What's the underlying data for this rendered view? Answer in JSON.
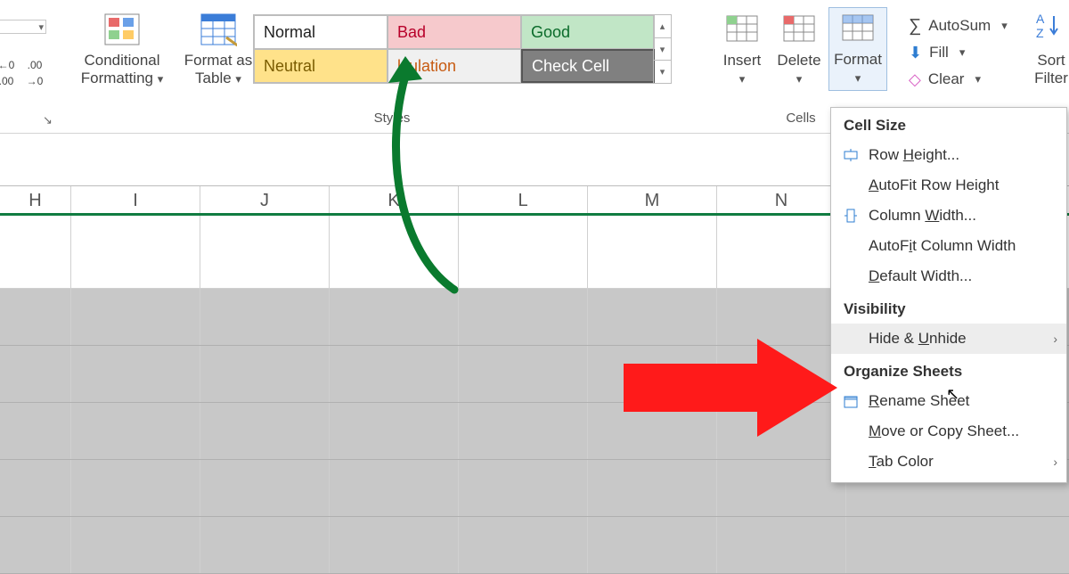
{
  "ribbon": {
    "styles_group_label": "Styles",
    "cells_group_label": "Cells",
    "conditional_formatting": "Conditional\nFormatting",
    "format_as_table": "Format as\nTable",
    "insert": "Insert",
    "delete": "Delete",
    "format": "Format",
    "editing": {
      "autosum": "AutoSum",
      "fill": "Fill",
      "clear": "Clear"
    },
    "sort_filter": "Sort &\nFilter"
  },
  "cell_styles": {
    "row1": [
      "Normal",
      "Bad",
      "Good"
    ],
    "row2": [
      "Neutral",
      "lculation",
      "Check Cell"
    ]
  },
  "columns": [
    "H",
    "I",
    "J",
    "K",
    "L",
    "M",
    "N"
  ],
  "format_menu": {
    "section_cell_size": "Cell Size",
    "row_height": "Row Height...",
    "autofit_row_height": "AutoFit Row Height",
    "column_width": "Column Width...",
    "autofit_column_width": "AutoFit Column Width",
    "default_width": "Default Width...",
    "section_visibility": "Visibility",
    "hide_unhide": "Hide & Unhide",
    "section_organize": "Organize Sheets",
    "rename_sheet": "Rename Sheet",
    "move_or_copy": "Move or Copy Sheet...",
    "tab_color": "Tab Color"
  },
  "colors": {
    "bad_bg": "#f6c9cc",
    "bad_fg": "#b8002a",
    "good_bg": "#c1e6c6",
    "good_fg": "#0a6b2a",
    "neutral_bg": "#ffe28a",
    "neutral_fg": "#7a5c00",
    "calc_fg": "#c75b12",
    "check_bg": "#808080",
    "check_fg": "#ffffff",
    "excel_green": "#107c41"
  }
}
